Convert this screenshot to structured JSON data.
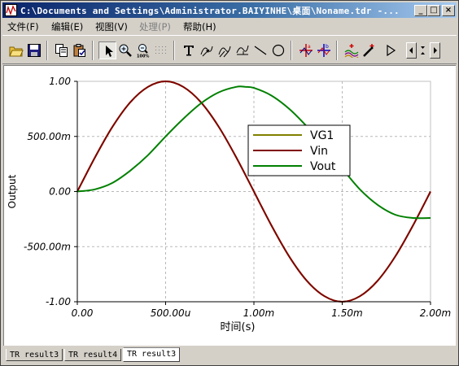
{
  "window": {
    "title": "C:\\Documents and Settings\\Administrator.BAIYINHE\\桌面\\Noname.tdr -...",
    "controls": {
      "minimize": "_",
      "maximize": "□",
      "close": "×"
    }
  },
  "menu": {
    "file": "文件(F)",
    "edit": "编辑(E)",
    "view": "视图(V)",
    "process": "处理(P)",
    "help": "帮助(H)"
  },
  "toolbar": {
    "icons": [
      "open-folder-icon",
      "save-icon",
      "copy-icon",
      "paste-icon",
      "pointer-icon",
      "zoom-in-icon",
      "zoom-100-icon",
      "grid-icon",
      "text-icon",
      "arrow-annotation-icon",
      "multi-annotation-icon",
      "level-annotation-icon",
      "line-icon",
      "circle-icon",
      "cursor-a-icon",
      "cursor-b-icon",
      "waveform-icon",
      "probe-icon",
      "play-icon",
      "scroll-left-icon",
      "scroll-right-icon"
    ]
  },
  "chart_data": {
    "type": "line",
    "xlabel": "时间(s)",
    "ylabel": "Output",
    "xlim": [
      0,
      0.002
    ],
    "ylim": [
      -1.0,
      1.0
    ],
    "x_ticks": [
      0,
      0.0005,
      0.001,
      0.0015,
      0.002
    ],
    "x_tick_labels": [
      "0.00",
      "500.00u",
      "1.00m",
      "1.50m",
      "2.00m"
    ],
    "y_ticks": [
      1.0,
      0.5,
      0.0,
      -0.5,
      -1.0
    ],
    "y_tick_labels": [
      "1.00",
      "500.00m",
      "0.00",
      "-500.00m",
      "-1.00"
    ],
    "grid": true,
    "legend_position": "upper-center-right",
    "series": [
      {
        "name": "VG1",
        "color": "#808000",
        "x": [
          0,
          0.0001,
          0.0002,
          0.0003,
          0.0004,
          0.0005,
          0.0006,
          0.0007,
          0.0008,
          0.0009,
          0.001,
          0.0011,
          0.0012,
          0.0013,
          0.0014,
          0.0015,
          0.0016,
          0.0017,
          0.0018,
          0.0019,
          0.002
        ],
        "y": [
          0,
          0.31,
          0.59,
          0.81,
          0.95,
          1.0,
          0.95,
          0.81,
          0.59,
          0.31,
          0,
          -0.31,
          -0.59,
          -0.81,
          -0.95,
          -1.0,
          -0.95,
          -0.81,
          -0.59,
          -0.31,
          0
        ]
      },
      {
        "name": "Vin",
        "color": "#800000",
        "x": [
          0,
          0.0001,
          0.0002,
          0.0003,
          0.0004,
          0.0005,
          0.0006,
          0.0007,
          0.0008,
          0.0009,
          0.001,
          0.0011,
          0.0012,
          0.0013,
          0.0014,
          0.0015,
          0.0016,
          0.0017,
          0.0018,
          0.0019,
          0.002
        ],
        "y": [
          0,
          0.31,
          0.59,
          0.81,
          0.95,
          1.0,
          0.95,
          0.81,
          0.59,
          0.31,
          0,
          -0.31,
          -0.59,
          -0.81,
          -0.95,
          -1.0,
          -0.95,
          -0.81,
          -0.59,
          -0.31,
          0
        ]
      },
      {
        "name": "Vout",
        "color": "#008000",
        "x": [
          0,
          0.0001,
          0.0002,
          0.0003,
          0.0004,
          0.0005,
          0.0006,
          0.0007,
          0.0008,
          0.0009,
          0.00095,
          0.001,
          0.0011,
          0.0012,
          0.0013,
          0.0014,
          0.0015,
          0.0016,
          0.0017,
          0.0018,
          0.0019,
          0.002
        ],
        "y": [
          0,
          0.02,
          0.08,
          0.19,
          0.33,
          0.5,
          0.66,
          0.8,
          0.9,
          0.95,
          0.95,
          0.94,
          0.87,
          0.75,
          0.59,
          0.41,
          0.21,
          0.02,
          -0.12,
          -0.21,
          -0.24,
          -0.24
        ]
      }
    ]
  },
  "tabs": [
    {
      "label": "TR result3",
      "active": false
    },
    {
      "label": "TR result4",
      "active": false
    },
    {
      "label": "TR result3",
      "active": true
    }
  ]
}
